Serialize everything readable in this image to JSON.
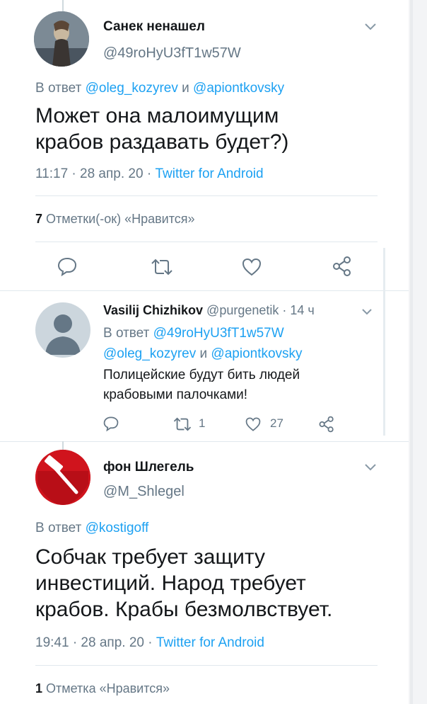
{
  "tweet1": {
    "name": "Санек ненашел",
    "handle": "@49roHyU3fT1w57W",
    "reply_prefix": "В ответ ",
    "reply_user1": "@oleg_kozyrev",
    "reply_and": " и ",
    "reply_user2": "@apiontkovsky",
    "text_line1": "Может она малоимущим",
    "text_line2": "крабов раздавать будет?)",
    "time_date": "11:17 · 28 апр. 20 · ",
    "client": "Twitter for Android",
    "likes_count": "7",
    "likes_label": " Отметки(-ок) «Нравится»"
  },
  "reply": {
    "name": "Vasilij Chizhikov",
    "handle_time": " @purgenetik · 14 ч",
    "reply_prefix": "В ответ ",
    "reply_user0": "@49roHyU3fT1w57W",
    "reply_user1": "@oleg_kozyrev",
    "reply_and": " и ",
    "reply_user2": "@apiontkovsky",
    "text_line1": "Полицейские будут бить людей",
    "text_line2": "крабовыми палочками!",
    "retweets": "1",
    "likes": "27"
  },
  "tweet2": {
    "name": "фон Шлегель",
    "handle": "@M_Shlegel",
    "reply_prefix": "В ответ ",
    "reply_user": "@kostigoff",
    "text_line1": "Собчак требует защиту",
    "text_line2": "инвестиций. Народ требует",
    "text_line3": "крабов. Крабы безмолвствует.",
    "time_date": "19:41 · 28 апр. 20 · ",
    "client": "Twitter for Android",
    "likes_count": "1",
    "likes_label": " Отметка «Нравится»"
  },
  "colors": {
    "link": "#1da1f2",
    "secondary": "#657786",
    "primary_text": "#14171a",
    "divider": "#e1e8ed"
  },
  "icons": [
    "chevron-down-icon",
    "reply-icon",
    "retweet-icon",
    "like-icon",
    "share-icon",
    "default-avatar-icon",
    "hammer-icon"
  ]
}
